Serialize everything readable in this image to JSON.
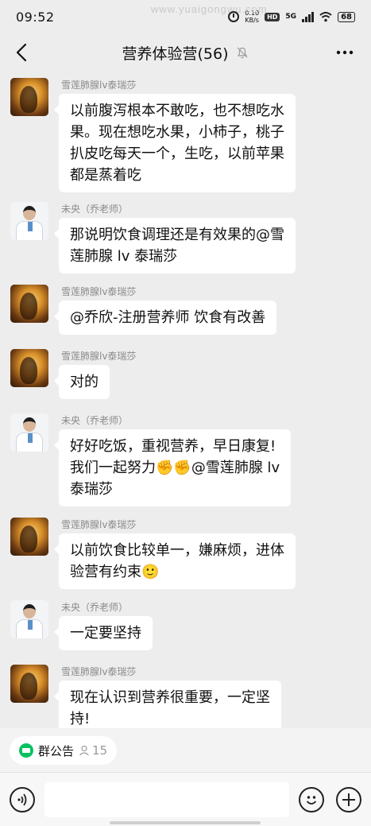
{
  "status_bar": {
    "time": "09:52",
    "watermark": "www.yuaigongwu.com",
    "net_speed_value": "0.10",
    "net_speed_unit": "KB/s",
    "hd": "HD",
    "network": "5G",
    "battery": "68"
  },
  "header": {
    "title": "营养体验营(56)"
  },
  "messages": [
    {
      "sender": "雪莲肺腺lv泰瑞莎",
      "lines": [
        "以前腹泻根本不敢吃，也不想吃水",
        "果。现在想吃水果，小柿子，桃子",
        "扒皮吃每天一个，生吃，以前苹果",
        "都是蒸着吃"
      ]
    },
    {
      "sender": "未央（乔老师）",
      "lines": [
        "那说明饮食调理还是有效果的@雪",
        "莲肺腺 lv 泰瑞莎"
      ]
    },
    {
      "sender": "雪莲肺腺lv泰瑞莎",
      "lines": [
        "@乔欣-注册营养师  饮食有改善"
      ]
    },
    {
      "sender": "雪莲肺腺lv泰瑞莎",
      "lines": [
        "对的"
      ]
    },
    {
      "sender": "未央（乔老师）",
      "lines": [
        "好好吃饭，重视营养，早日康复!",
        "我们一起努力✊✊@雪莲肺腺 lv",
        "泰瑞莎"
      ]
    },
    {
      "sender": "雪莲肺腺lv泰瑞莎",
      "lines": [
        "以前饮食比较单一，嫌麻烦，进体",
        "验营有约束🙂"
      ]
    },
    {
      "sender": "未央（乔老师）",
      "lines": [
        "一定要坚持"
      ]
    },
    {
      "sender": "雪莲肺腺lv泰瑞莎",
      "lines": [
        "现在认识到营养很重要，一定坚",
        "持!"
      ]
    }
  ],
  "notice": {
    "label": "群公告",
    "count": "15"
  },
  "colors": {
    "background": "#ededed",
    "bubble": "#ffffff",
    "accent_green": "#07c160"
  },
  "icons": [
    "back-icon",
    "mute-icon",
    "more-icon",
    "voice-icon",
    "emoji-icon",
    "plus-icon",
    "notice-icon",
    "person-icon"
  ]
}
